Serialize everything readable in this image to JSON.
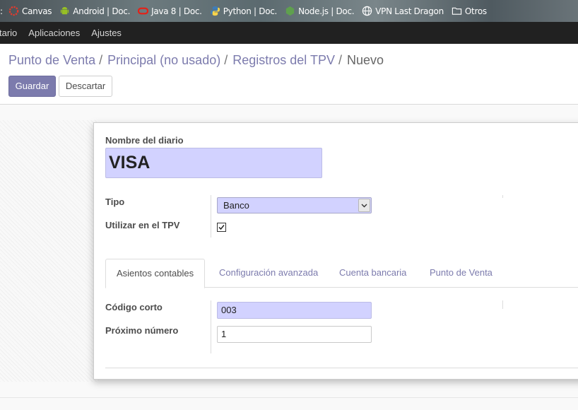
{
  "bookmarks": {
    "lead": ":",
    "items": [
      {
        "label": "Canvas",
        "icon": "canvas-icon"
      },
      {
        "label": "Android | Doc.",
        "icon": "android-icon"
      },
      {
        "label": "Java 8 | Doc.",
        "icon": "oracle-icon"
      },
      {
        "label": "Python | Doc.",
        "icon": "python-icon"
      },
      {
        "label": "Node.js |  Doc.",
        "icon": "nodejs-icon"
      },
      {
        "label": "VPN Last Dragon",
        "icon": "globe-icon"
      },
      {
        "label": "Otros",
        "icon": "folder-icon"
      }
    ]
  },
  "nav": {
    "items": [
      "tario",
      "Aplicaciones",
      "Ajustes"
    ]
  },
  "breadcrumb": {
    "items": [
      "Punto de Venta",
      "Principal (no usado)",
      "Registros del TPV"
    ],
    "separator": "/",
    "current": "Nuevo"
  },
  "buttons": {
    "save": "Guardar",
    "discard": "Descartar"
  },
  "form": {
    "name_label": "Nombre del diario",
    "name_value": "VISA",
    "type_label": "Tipo",
    "type_value": "Banco",
    "pos_label": "Utilizar en el TPV",
    "pos_checked": true,
    "tabs": [
      "Asientos contables",
      "Configuración avanzada",
      "Cuenta bancaria",
      "Punto de Venta"
    ],
    "active_tab": "Asientos contables",
    "short_code_label": "Código corto",
    "short_code_value": "003",
    "next_number_label": "Próximo número",
    "next_number_value": "1"
  },
  "colors": {
    "brand": "#7c7bad",
    "required_field": "#d2d2ff",
    "navbar": "#212121"
  }
}
